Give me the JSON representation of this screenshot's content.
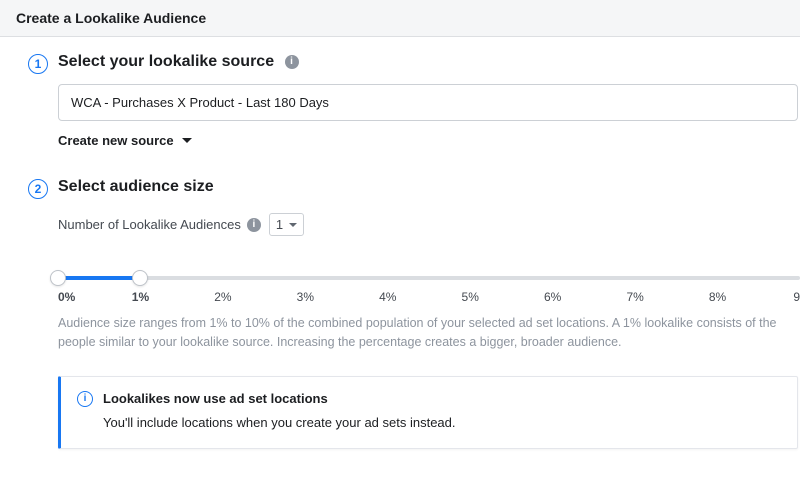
{
  "header": {
    "title": "Create a Lookalike Audience"
  },
  "step1": {
    "number": "1",
    "title": "Select your lookalike source",
    "source_value": "WCA - Purchases X Product - Last 180 Days",
    "create_new_label": "Create new source"
  },
  "step2": {
    "number": "2",
    "title": "Select audience size",
    "num_audiences_label": "Number of Lookalike Audiences",
    "num_audiences_value": "1",
    "slider": {
      "min_pct": 0,
      "max_pct": 9,
      "sel_start_pct": 0,
      "sel_end_pct": 1,
      "ticks": [
        "0%",
        "1%",
        "2%",
        "3%",
        "4%",
        "5%",
        "6%",
        "7%",
        "8%",
        "9"
      ]
    },
    "helper_text": "Audience size ranges from 1% to 10% of the combined population of your selected ad set locations. A 1% lookalike consists of the people similar to your lookalike source. Increasing the percentage creates a bigger, broader audience."
  },
  "notice": {
    "title": "Lookalikes now use ad set locations",
    "body": "You'll include locations when you create your ad sets instead."
  }
}
